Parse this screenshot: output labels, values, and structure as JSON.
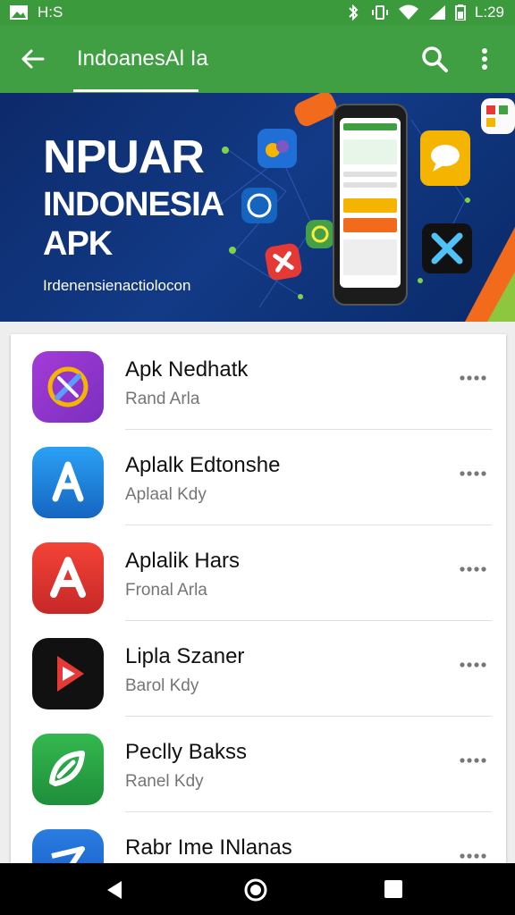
{
  "status_bar": {
    "left_label": "H:S",
    "time": "L:29",
    "accent": "#3a9a3c"
  },
  "app_bar": {
    "title": "IndoanesAl Ia",
    "color": "#3f9f42"
  },
  "banner": {
    "heading_line1": "NPUAR",
    "heading_line2": "INDONESIA",
    "heading_line3": "APK",
    "subtitle": "Irdenensienactiolocon",
    "background": "#123a86"
  },
  "apps": [
    {
      "name": "Apk Nedhatk",
      "subtitle": "Rand Arla",
      "icon": "compass-icon",
      "color": "#8e35c9"
    },
    {
      "name": "Aplalk Edtonshe",
      "subtitle": "Aplaal Kdy",
      "icon": "app-store-icon",
      "color": "#1e88e5"
    },
    {
      "name": "Aplalik Hars",
      "subtitle": "Fronal Arla",
      "icon": "a-letter-icon",
      "color": "#e53935"
    },
    {
      "name": "Lipla Szaner",
      "subtitle": "Barol Kdy",
      "icon": "play-icon",
      "color": "#111111"
    },
    {
      "name": "Peclly Bakss",
      "subtitle": "Ranel Kdy",
      "icon": "leaf-icon",
      "color": "#2eaa44"
    },
    {
      "name": "Rabr Ime INlanas",
      "subtitle": "",
      "icon": "blue-app-icon",
      "color": "#1e6fd9"
    }
  ],
  "nav_bar": {
    "back": "back-icon",
    "home": "home-icon",
    "recents": "recents-icon"
  }
}
